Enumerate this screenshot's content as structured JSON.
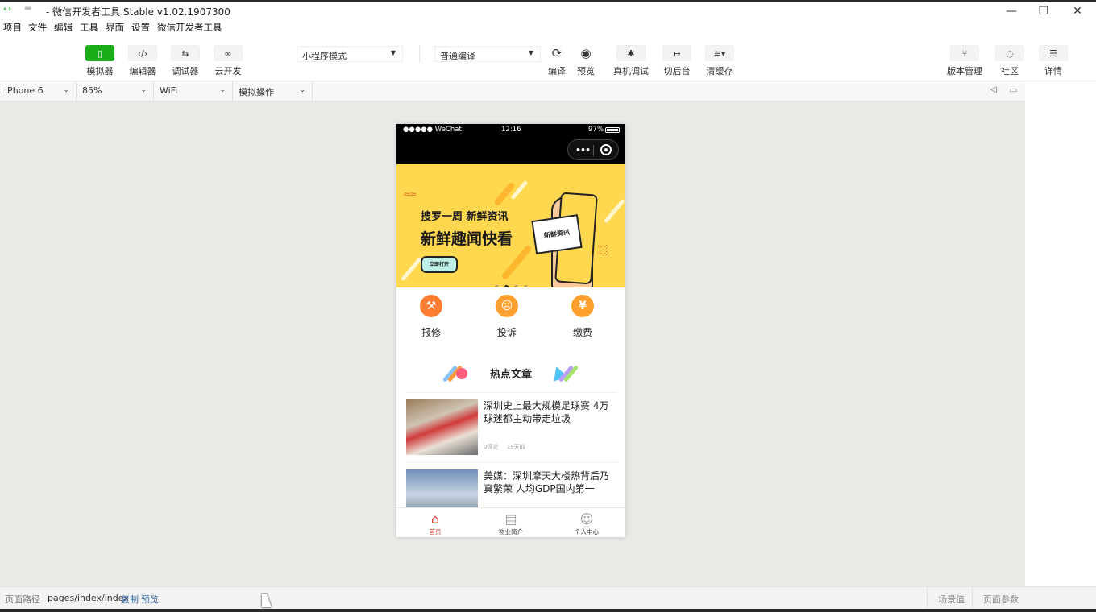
{
  "window": {
    "title": "- 微信开发者工具 Stable v1.02.1907300",
    "controls": {
      "minimize": "—",
      "maximize": "❐",
      "close": "✕"
    }
  },
  "menu": [
    "项目",
    "文件",
    "编辑",
    "工具",
    "界面",
    "设置",
    "微信开发者工具"
  ],
  "toolbar": {
    "simulator": "模拟器",
    "editor": "编辑器",
    "debugger": "调试器",
    "cloud": "云开发",
    "mode_select": "小程序模式",
    "compile_select": "普通编译",
    "compile": "编译",
    "preview": "预览",
    "remote_debug": "真机调试",
    "background": "切后台",
    "clear_cache": "清缓存",
    "version": "版本管理",
    "community": "社区",
    "details": "详情"
  },
  "device_bar": {
    "device": "iPhone 6",
    "zoom": "85%",
    "network": "WiFi",
    "operation": "模拟操作"
  },
  "phone": {
    "status": {
      "carrier": "●●●●● WeChat",
      "time": "12:16",
      "battery": "97%"
    },
    "banner": {
      "line1": "搜罗一周  新鲜资讯",
      "line2": "新鲜趣闻快看",
      "button": "立即打开",
      "card": "新鲜资讯",
      "active_dot": 1
    },
    "shortcuts": [
      {
        "label": "报修",
        "icon": "wrench-icon"
      },
      {
        "label": "投诉",
        "icon": "face-icon"
      },
      {
        "label": "缴费",
        "icon": "yen-icon"
      }
    ],
    "hot_title": "热点文章",
    "articles": [
      {
        "title": "深圳史上最大规模足球赛 4万球迷都主动带走垃圾",
        "comments": "0评论",
        "time": "19天前"
      },
      {
        "title": "美媒：深圳摩天大楼热背后乃真繁荣 人均GDP国内第一"
      }
    ],
    "tabs": [
      {
        "label": "首页",
        "active": true
      },
      {
        "label": "物业简介",
        "active": false
      },
      {
        "label": "个人中心",
        "active": false
      }
    ]
  },
  "statusbar": {
    "path_label": "页面路径",
    "path": "pages/index/index",
    "copy": "复制",
    "preview": "预览",
    "scene": "场景值",
    "params": "页面参数"
  }
}
